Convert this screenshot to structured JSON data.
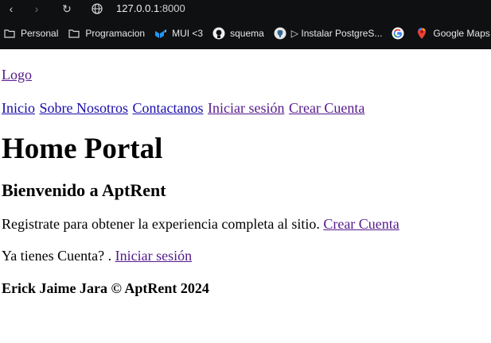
{
  "browser": {
    "url_host": "127.0.0.1",
    "url_port": ":8000",
    "bookmarks": [
      {
        "label": "Personal",
        "icon": "folder-icon"
      },
      {
        "label": "Programacion",
        "icon": "folder-icon"
      },
      {
        "label": "MUI <3",
        "icon": "mui-logo-icon"
      },
      {
        "label": "squema",
        "icon": "github-icon"
      },
      {
        "label": "▷ Instalar PostgreS...",
        "icon": "postgres-elephant-icon"
      },
      {
        "label": "",
        "icon": "google-icon"
      },
      {
        "label": "Google Maps",
        "icon": "google-maps-icon"
      }
    ]
  },
  "header": {
    "logo": "Logo",
    "nav": [
      "Inicio",
      "Sobre Nosotros",
      "Contactanos",
      "Iniciar sesión",
      "Crear Cuenta"
    ]
  },
  "main": {
    "title": "Home Portal",
    "subtitle": "Bienvenido a AptRent",
    "register_text": "Registrate para obtener la experiencia completa al sitio.",
    "register_link": "Crear Cuenta",
    "login_text": "Ya tienes Cuenta? .",
    "login_link": "Iniciar sesión"
  },
  "footer": {
    "text": "Erick Jaime Jara © AptRent 2024"
  }
}
